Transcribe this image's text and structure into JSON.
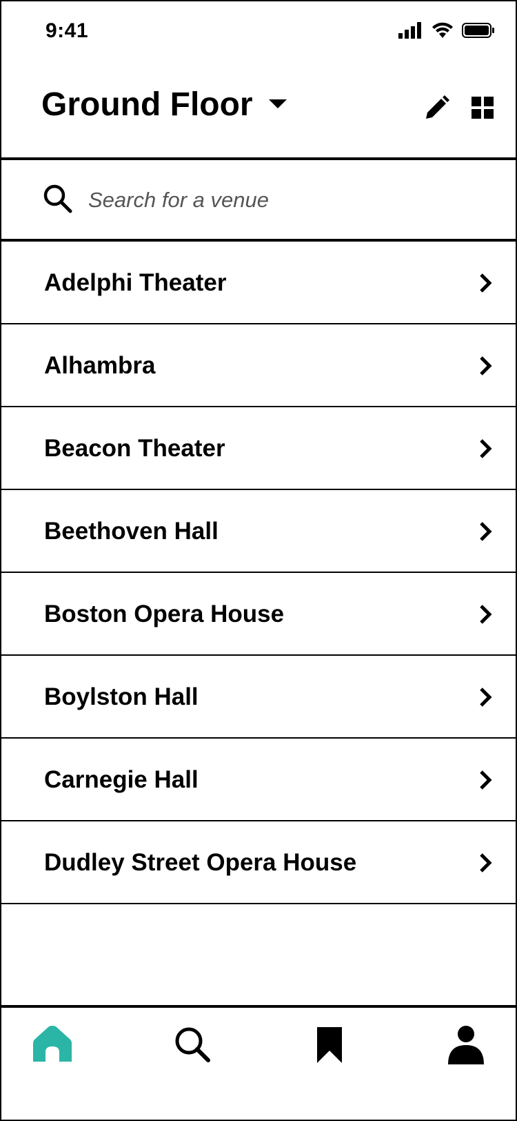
{
  "status_bar": {
    "time": "9:41"
  },
  "header": {
    "title": "Ground Floor"
  },
  "search": {
    "placeholder": "Search for a venue"
  },
  "venues": [
    "Adelphi Theater",
    "Alhambra",
    "Beacon Theater",
    "Beethoven Hall",
    "Boston Opera House",
    "Boylston Hall",
    "Carnegie Hall",
    "Dudley Street Opera House"
  ],
  "tab_bar": {
    "items": [
      "home",
      "search",
      "saved",
      "profile"
    ],
    "active": "home"
  },
  "colors": {
    "accent": "#2bb5a6",
    "text": "#000000",
    "placeholder": "#555555",
    "background": "#ffffff"
  },
  "icons": {
    "status": [
      "signal-icon",
      "wifi-icon",
      "battery-icon"
    ],
    "header": [
      "pencil-icon",
      "grid-icon"
    ],
    "search": "search-icon",
    "row": "chevron-right-icon",
    "tabs": [
      "home-icon",
      "search-icon",
      "bookmark-icon",
      "person-icon"
    ]
  }
}
